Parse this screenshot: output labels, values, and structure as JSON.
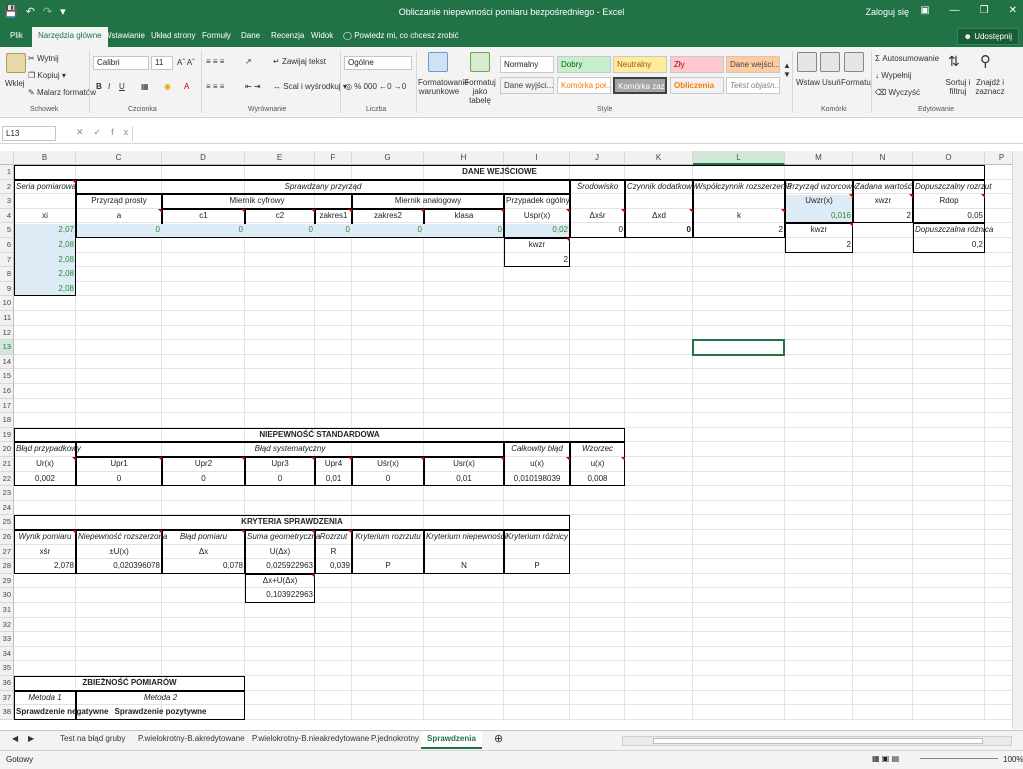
{
  "titlebar": {
    "title": "Obliczanie niepewności pomiaru bezpośredniego  -  Excel",
    "signin": "Zaloguj się"
  },
  "tabs": {
    "items": [
      "Plik",
      "Narzędzia główne",
      "Wstawianie",
      "Układ strony",
      "Formuły",
      "Dane",
      "Recenzja",
      "Widok"
    ],
    "tell_me": "Powiedz mi, co chcesz zrobić",
    "share": "Udostępnij"
  },
  "ribbon": {
    "paste": "Wklej",
    "cut": "Wytnij",
    "copy": "Kopiuj",
    "format_painter": "Malarz formatów",
    "font_name": "Calibri",
    "font_size": "11",
    "wrap_text": "Zawijaj tekst",
    "merge_center": "Scal i wyśrodkuj",
    "number_format": "Ogólne",
    "cond_format": "Formatowanie warunkowe",
    "format_table": "Formatuj jako tabelę",
    "styles": [
      "Normalny",
      "Dobry",
      "Neutralny",
      "Zły",
      "Dane wejści...",
      "Dane wyjści...",
      "Komórka poł...",
      "Komórka zaz...",
      "Obliczenia",
      "Tekst objaśn..."
    ],
    "insert": "Wstaw",
    "delete": "Usuń",
    "format": "Formatuj",
    "autosum": "Autosumowanie",
    "fill": "Wypełnij",
    "clear": "Wyczyść",
    "sort_filter": "Sortuj i filtruj",
    "find_select": "Znajdź i zaznacz",
    "groups": [
      "Schowek",
      "Czcionka",
      "Wyrównanie",
      "Liczba",
      "Style",
      "Komórki",
      "Edytowanie"
    ]
  },
  "formula_bar": {
    "name_box": "L13",
    "fx": "fx"
  },
  "grid": {
    "columns": [
      "B",
      "C",
      "D",
      "E",
      "F",
      "G",
      "H",
      "I",
      "J",
      "K",
      "L",
      "M",
      "N",
      "O",
      "P"
    ],
    "selected_column": "L",
    "selected_row": "13",
    "rows": [
      "1",
      "2",
      "3",
      "4",
      "5",
      "6",
      "7",
      "8",
      "9",
      "10",
      "11",
      "12",
      "13",
      "14",
      "15",
      "16",
      "17",
      "18",
      "19",
      "20",
      "21",
      "22",
      "23",
      "24",
      "25",
      "26",
      "27",
      "28",
      "29",
      "30",
      "31",
      "32",
      "33",
      "34",
      "35",
      "36",
      "37",
      "38"
    ]
  },
  "cells": {
    "dane_wejsciowe": "DANE WEJŚCIOWE",
    "seria_pomiarowa": "Seria pomiarowa",
    "sprawdzany_przyrzad": "Sprawdzany przyrząd",
    "srodowisko": "Środowisko",
    "czynnik_dodatkowy": "Czynnik dodatkowy",
    "wsp_rozszerzenia": "Współczynnik rozszerzenia",
    "przyrzad_wzorcowy": "Przyrząd wzorcowy",
    "zadana_wartosc": "Zadana wartość",
    "dopuszczalny_rozrzut": "Dopuszczalny rozrzut",
    "przyrzad_prosty": "Przyrząd prosty",
    "miernik_cyfrowy": "Miernik cyfrowy",
    "miernik_analogowy": "Miernik analogowy",
    "przypadek_ogolny": "Przypadek ogólny",
    "xi": "xi",
    "a": "a",
    "c1": "c1",
    "c2": "c2",
    "zakres1": "zakres1",
    "zakres2": "zakres2",
    "klasa": "klasa",
    "uspr": "Uspr(x)",
    "dxsr": "Δxśr",
    "dxd": "Δxd",
    "k": "k",
    "uwzr": "Uwzr(x)",
    "xwzr": "xwzr",
    "rdop": "Rdop",
    "b5": "2,07",
    "b6": "2,08",
    "b7": "2,08",
    "b8": "2,08",
    "b9": "2,08",
    "c5": "0",
    "d5": "0",
    "e5": "0",
    "f5": "0",
    "g5": "0",
    "h5": "0",
    "i5": "0,02",
    "j5": "0",
    "k5": "0",
    "l5": "2",
    "m4": "0,016",
    "n4": "2",
    "o4": "0,05",
    "m5": "kwzr",
    "m6": "2",
    "o5": "Dopuszczalna różnica",
    "o6": "0,2",
    "i6": "kwzr",
    "i7": "2",
    "niepewnosc_std": "NIEPEWNOŚĆ STANDARDOWA",
    "blad_przypadkowy": "Błąd przypadkowy",
    "blad_systematyczny": "Błąd systematyczny",
    "calkowity_blad": "Całkowity błąd",
    "wzorzec": "Wzorzec",
    "ur": "Ur(x)",
    "upr1": "Upr1",
    "upr2": "Upr2",
    "upr3": "Upr3",
    "upr4": "Upr4",
    "usr": "Uśr(x)",
    "usr2": "Usr(x)",
    "ux": "u(x)",
    "ux2": "u(x)",
    "b22": "0,002",
    "c22": "0",
    "d22": "0",
    "e22": "0",
    "f22": "0,01",
    "g22": "0",
    "h22": "0,01",
    "i22": "0,010198039",
    "j22": "0,008",
    "kryteria": "KRYTERIA SPRAWDZENIA",
    "wynik_pomiaru": "Wynik pomiaru",
    "niepewnosc_rozszerzona": "Niepewność rozszerzona",
    "blad_pomiaru": "Błąd pomiaru",
    "suma_geometryczna": "Suma geometryczna",
    "rozrzut": "Rozrzut",
    "kryterium_rozrzutu": "Kryterium rozrzutu",
    "kryterium_niepewnosci": "Kryterium niepewności",
    "kryterium_roznicy": "Kryterium różnicy",
    "xsr": "xśr",
    "pm_ux": "±U(x)",
    "dx": "Δx",
    "udx": "U(Δx)",
    "R": "R",
    "b28": "2,078",
    "c28": "0,020396078",
    "d28": "0,078",
    "e28": "0,025922963",
    "f28": "0,039",
    "g28": "P",
    "h28": "N",
    "i28": "P",
    "e29": "Δx+U(Δx)",
    "e30": "0,103922963",
    "zbieznosc": "ZBIEŻNOŚĆ POMIARÓW",
    "metoda1": "Metoda 1",
    "metoda2": "Metoda 2",
    "spr_neg": "Sprawdzenie negatywne",
    "spr_poz": "Sprawdzenie pozytywne"
  },
  "sheets": {
    "tabs": [
      "Test na błąd gruby",
      "P.wielokrotny-B.akredytowane",
      "P.wielokrotny-B.nieakredytowane",
      "P.jednokrotny",
      "Sprawdzenia"
    ],
    "active": "Sprawdzenia"
  },
  "status": {
    "ready": "Gotowy",
    "zoom": "100%"
  },
  "colors": {
    "accent": "#217346",
    "green_text": "#2f8a2f",
    "input_bg": "#ddebf7"
  }
}
